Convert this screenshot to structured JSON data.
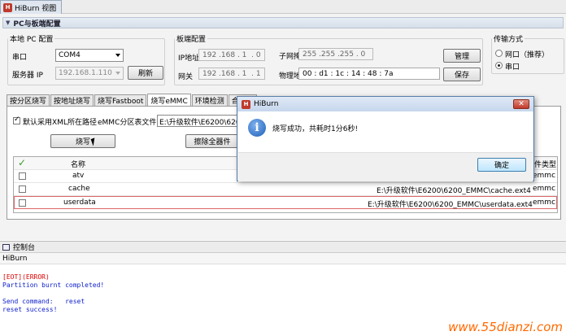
{
  "window": {
    "title": "HiBurn 视图"
  },
  "section": {
    "title": "PC与板端配置"
  },
  "pc_config": {
    "legend": "本地 PC 配置",
    "port_label": "串口",
    "port_value": "COM4",
    "server_ip_label": "服务器 IP",
    "server_ip_value": "192.168.1.110",
    "refresh_button": "刷新"
  },
  "board_config": {
    "legend": "板端配置",
    "ip_label": "IP地址",
    "ip_value": "192 .168 . 1  . 0",
    "gateway_label": "网关",
    "gateway_value": "192 .168 . 1  . 1",
    "subnet_label": "子网掩码",
    "subnet_value": "255 .255 .255 . 0",
    "mac_label": "物理地址",
    "mac_value": "00 : d1 : 1c : 14 : 48 : 7a",
    "manage_button": "管理",
    "save_button": "保存"
  },
  "transfer": {
    "legend": "传输方式",
    "option_net": "网口（推荐）",
    "option_serial": "串口",
    "selected": "串口"
  },
  "tabs": [
    {
      "label": "按分区烧写"
    },
    {
      "label": "按地址烧写"
    },
    {
      "label": "烧写Fastboot"
    },
    {
      "label": "烧写eMMC",
      "active": true
    },
    {
      "label": "环境检测"
    },
    {
      "label": "合并镜"
    }
  ],
  "emmc": {
    "default_xml_label": "默认采用XML所在路径",
    "partition_file_label": "eMMC分区表文件",
    "partition_file_value": "E:\\升级软件\\E6200\\6200_",
    "burn_button": "烧写",
    "erase_button": "擦除全器件",
    "columns": {
      "name": "名称",
      "type": "件类型"
    },
    "rows": [
      {
        "name": "atv",
        "path": "",
        "type": "emmc"
      },
      {
        "name": "cache",
        "path": "E:\\升级软件\\E6200\\6200_EMMC\\cache.ext4",
        "type": "emmc"
      },
      {
        "name": "userdata",
        "path": "E:\\升级软件\\E6200\\6200_EMMC\\userdata.ext4",
        "type": "emmc"
      }
    ]
  },
  "console": {
    "tab_label": "控制台",
    "title": "HiBurn",
    "lines": [
      {
        "text": "[EOT](ERROR)",
        "kind": "err"
      },
      {
        "text": "Partition burnt completed!",
        "kind": "ok"
      },
      {
        "text": "",
        "kind": "ok"
      },
      {
        "text": "Send command:   reset",
        "kind": "ok"
      },
      {
        "text": "reset success!",
        "kind": "ok"
      }
    ]
  },
  "dialog": {
    "title": "HiBurn",
    "message": "烧写成功，共耗时1分6秒!",
    "ok_button": "确定",
    "close_glyph": "✕"
  },
  "watermark": "www.55dianzi.com",
  "colors": {
    "error": "#dd0000",
    "log": "#1122cc",
    "watermark": "#ff6a00"
  }
}
